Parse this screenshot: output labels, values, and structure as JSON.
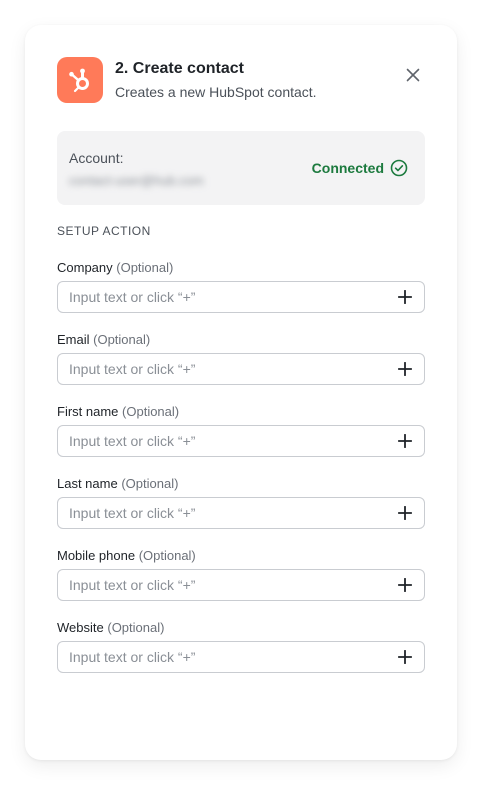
{
  "header": {
    "title": "2. Create contact",
    "subtitle": "Creates a new HubSpot contact.",
    "icon": "hubspot-icon",
    "brand_color": "#ff7a59"
  },
  "account": {
    "label": "Account:",
    "email": "contact-user@hub.com",
    "status": "Connected",
    "status_color": "#1c7a3e"
  },
  "setup": {
    "section_title": "SETUP ACTION",
    "fields": [
      {
        "label": "Company",
        "optional": "(Optional)",
        "placeholder": "Input text or click “+”",
        "value": ""
      },
      {
        "label": "Email",
        "optional": "(Optional)",
        "placeholder": "Input text or click “+”",
        "value": ""
      },
      {
        "label": "First name",
        "optional": "(Optional)",
        "placeholder": "Input text or click “+”",
        "value": ""
      },
      {
        "label": "Last name",
        "optional": "(Optional)",
        "placeholder": "Input text or click “+”",
        "value": ""
      },
      {
        "label": "Mobile phone",
        "optional": "(Optional)",
        "placeholder": "Input text or click “+”",
        "value": ""
      },
      {
        "label": "Website",
        "optional": "(Optional)",
        "placeholder": "Input text or click “+”",
        "value": ""
      }
    ]
  }
}
